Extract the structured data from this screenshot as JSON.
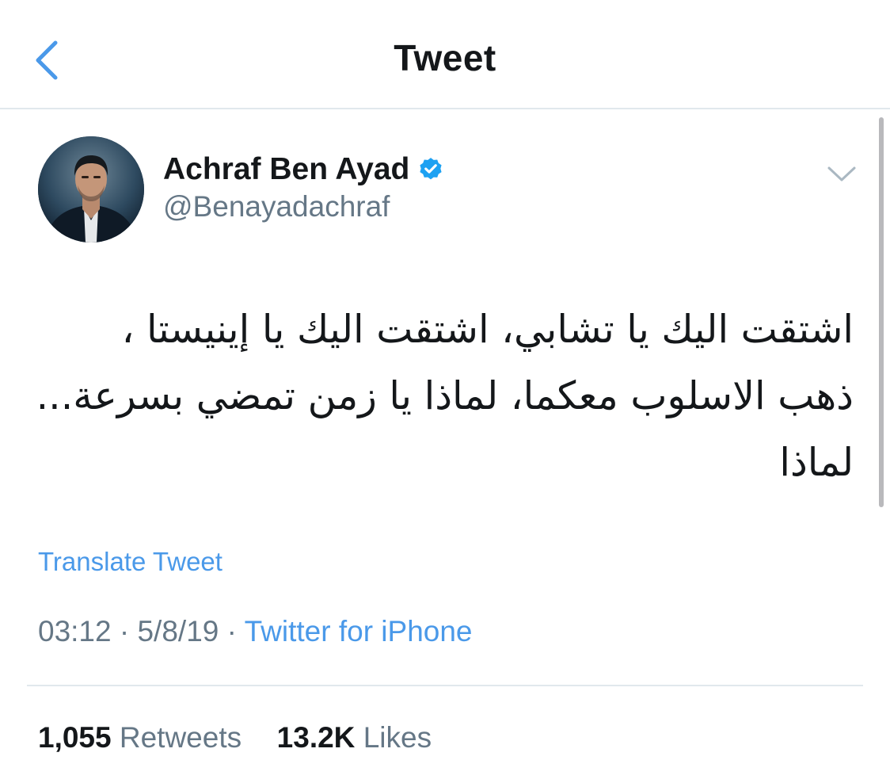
{
  "header": {
    "title": "Tweet",
    "back_icon": "chevron-left-icon"
  },
  "tweet": {
    "author": {
      "display_name": "Achraf Ben Ayad",
      "handle": "@Benayadachraf",
      "verified": true
    },
    "text_lines": [
      "اشتقت اليك يا تشابي، اشتقت اليك يا إينيستا ،",
      "ذهب الاسلوب معكما، لماذا يا زمن تمضي بسرعة...",
      "لماذا"
    ],
    "translate_label": "Translate Tweet",
    "time": "03:12",
    "date": "5/8/19",
    "separator": "·",
    "source": "Twitter for iPhone",
    "stats": {
      "retweets_count": "1,055",
      "retweets_label": "Retweets",
      "likes_count": "13.2K",
      "likes_label": "Likes"
    }
  },
  "colors": {
    "accent": "#4a99e9",
    "text_primary": "#14171a",
    "text_secondary": "#657786",
    "divider": "#e1e8ed"
  }
}
